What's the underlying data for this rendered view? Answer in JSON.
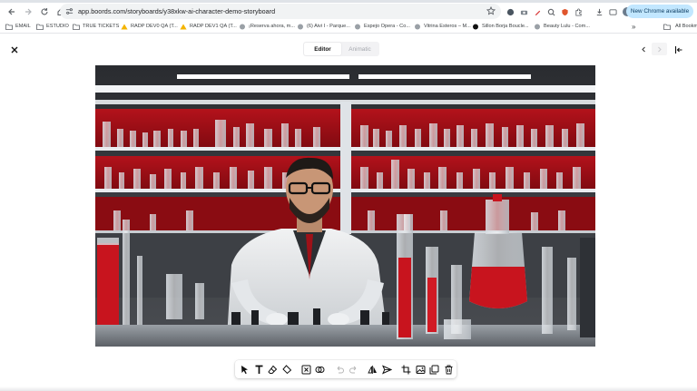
{
  "browser": {
    "url": "app.boords.com/storyboards/y38xkw-ai-character-demo-storyboard",
    "update_label": "New Chrome available",
    "nav_icons": [
      "back-arrow-icon",
      "forward-arrow-icon",
      "reload-icon",
      "home-icon"
    ],
    "bookmarks": [
      {
        "label": "EMAIL",
        "icon": "folder-icon"
      },
      {
        "label": "ESTUDIO",
        "icon": "folder-icon"
      },
      {
        "label": "TRUE TICKETS",
        "icon": "folder-icon"
      },
      {
        "label": "RADP DEV0 QA (T...",
        "icon": "warning-icon"
      },
      {
        "label": "RADP DEV1 QA (T...",
        "icon": "warning-icon"
      },
      {
        "label": "¡Reserva ahora, m...",
        "icon": "site-icon"
      },
      {
        "label": "(6) Aivi I - Parque...",
        "icon": "site-icon"
      },
      {
        "label": "Espejo Opera - Co...",
        "icon": "site-icon"
      },
      {
        "label": "Vitrina Esteros – M...",
        "icon": "site-icon"
      },
      {
        "label": "Sillon Borja Boucle...",
        "icon": "site-icon"
      },
      {
        "label": "Beauty Lulu - Com...",
        "icon": "site-icon"
      }
    ],
    "more_bookmarks": "»",
    "all_bookmarks": "All Bookmarks"
  },
  "editor": {
    "tabs": [
      {
        "label": "Editor",
        "active": true
      },
      {
        "label": "Animatic",
        "active": false
      }
    ],
    "image_alt": "Scientist in a white lab coat working with glassware and red liquids in a laboratory",
    "toolbar_tools": [
      {
        "name": "select-tool",
        "icon": "pointer-icon",
        "enabled": true
      },
      {
        "name": "text-tool",
        "icon": "text-icon",
        "enabled": true
      },
      {
        "name": "eraser-tool",
        "icon": "eraser-icon",
        "enabled": true
      },
      {
        "name": "fill-tool",
        "icon": "bucket-icon",
        "enabled": true
      },
      {
        "name": "clear-tool",
        "icon": "clear-frame-icon",
        "enabled": true
      },
      {
        "name": "mask-tool",
        "icon": "overlap-circles-icon",
        "enabled": true
      },
      {
        "name": "undo-tool",
        "icon": "undo-icon",
        "enabled": false
      },
      {
        "name": "redo-tool",
        "icon": "redo-icon",
        "enabled": false
      },
      {
        "name": "flip-tool",
        "icon": "flip-horizontal-icon",
        "enabled": true
      },
      {
        "name": "send-tool",
        "icon": "send-icon",
        "enabled": true
      },
      {
        "name": "crop-tool",
        "icon": "crop-icon",
        "enabled": true
      },
      {
        "name": "image-tool",
        "icon": "image-icon",
        "enabled": true
      },
      {
        "name": "duplicate-tool",
        "icon": "duplicate-icon",
        "enabled": true
      },
      {
        "name": "delete-tool",
        "icon": "trash-icon",
        "enabled": true
      }
    ]
  },
  "colors": {
    "accent_pill": "#c2e7ff",
    "lab_red": "#c8141e",
    "omnibox": "#f1f3f4"
  }
}
